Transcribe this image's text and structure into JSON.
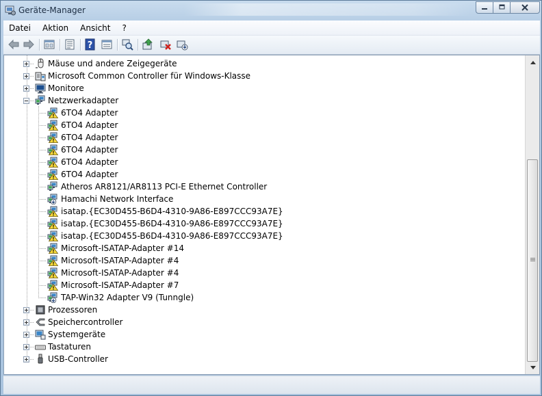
{
  "window": {
    "title": "Geräte-Manager",
    "accent": "#b8cfe6"
  },
  "menu": [
    "Datei",
    "Aktion",
    "Ansicht",
    "?"
  ],
  "toolbar": [
    {
      "name": "back-icon"
    },
    {
      "name": "forward-icon"
    },
    {
      "name": "up-level-icon"
    },
    {
      "name": "properties-icon"
    },
    {
      "name": "help-icon"
    },
    {
      "name": "details-view-icon"
    },
    {
      "name": "scan-hardware-icon"
    },
    {
      "name": "update-driver-icon"
    },
    {
      "name": "uninstall-icon"
    },
    {
      "name": "enable-device-icon"
    }
  ],
  "tree": [
    {
      "label": "Mäuse und andere Zeigegeräte",
      "level": 0,
      "expander": "plus",
      "icon": "mouse-icon"
    },
    {
      "label": "Microsoft Common Controller für Windows-Klasse",
      "level": 0,
      "expander": "plus",
      "icon": "controller-icon"
    },
    {
      "label": "Monitore",
      "level": 0,
      "expander": "plus",
      "icon": "monitor-icon"
    },
    {
      "label": "Netzwerkadapter",
      "level": 0,
      "expander": "minus",
      "icon": "network-icon"
    },
    {
      "label": "6TO4 Adapter",
      "level": 1,
      "icon": "network-warning-icon"
    },
    {
      "label": "6TO4 Adapter",
      "level": 1,
      "icon": "network-warning-icon"
    },
    {
      "label": "6TO4 Adapter",
      "level": 1,
      "icon": "network-warning-icon"
    },
    {
      "label": "6TO4 Adapter",
      "level": 1,
      "icon": "network-warning-icon"
    },
    {
      "label": "6TO4 Adapter",
      "level": 1,
      "icon": "network-warning-icon"
    },
    {
      "label": "6TO4 Adapter",
      "level": 1,
      "icon": "network-warning-icon"
    },
    {
      "label": "Atheros AR8121/AR8113 PCI-E Ethernet Controller",
      "level": 1,
      "icon": "network-icon"
    },
    {
      "label": "Hamachi Network Interface",
      "level": 1,
      "icon": "network-disabled-icon"
    },
    {
      "label": "isatap.{EC30D455-B6D4-4310-9A86-E897CCC93A7E}",
      "level": 1,
      "icon": "network-warning-icon"
    },
    {
      "label": "isatap.{EC30D455-B6D4-4310-9A86-E897CCC93A7E}",
      "level": 1,
      "icon": "network-warning-icon"
    },
    {
      "label": "isatap.{EC30D455-B6D4-4310-9A86-E897CCC93A7E}",
      "level": 1,
      "icon": "network-warning-icon"
    },
    {
      "label": "Microsoft-ISATAP-Adapter #14",
      "level": 1,
      "icon": "network-warning-icon"
    },
    {
      "label": "Microsoft-ISATAP-Adapter #4",
      "level": 1,
      "icon": "network-warning-icon"
    },
    {
      "label": "Microsoft-ISATAP-Adapter #4",
      "level": 1,
      "icon": "network-warning-icon"
    },
    {
      "label": "Microsoft-ISATAP-Adapter #7",
      "level": 1,
      "icon": "network-warning-icon"
    },
    {
      "label": "TAP-Win32 Adapter V9 (Tunngle)",
      "level": 1,
      "icon": "network-disabled-icon"
    },
    {
      "label": "Prozessoren",
      "level": 0,
      "expander": "plus",
      "icon": "processor-icon"
    },
    {
      "label": "Speichercontroller",
      "level": 0,
      "expander": "plus",
      "icon": "storage-controller-icon"
    },
    {
      "label": "Systemgeräte",
      "level": 0,
      "expander": "plus",
      "icon": "system-devices-icon"
    },
    {
      "label": "Tastaturen",
      "level": 0,
      "expander": "plus",
      "icon": "keyboard-icon"
    },
    {
      "label": "USB-Controller",
      "level": 0,
      "expander": "plus",
      "icon": "usb-icon"
    }
  ],
  "scroll_position": 0.67
}
